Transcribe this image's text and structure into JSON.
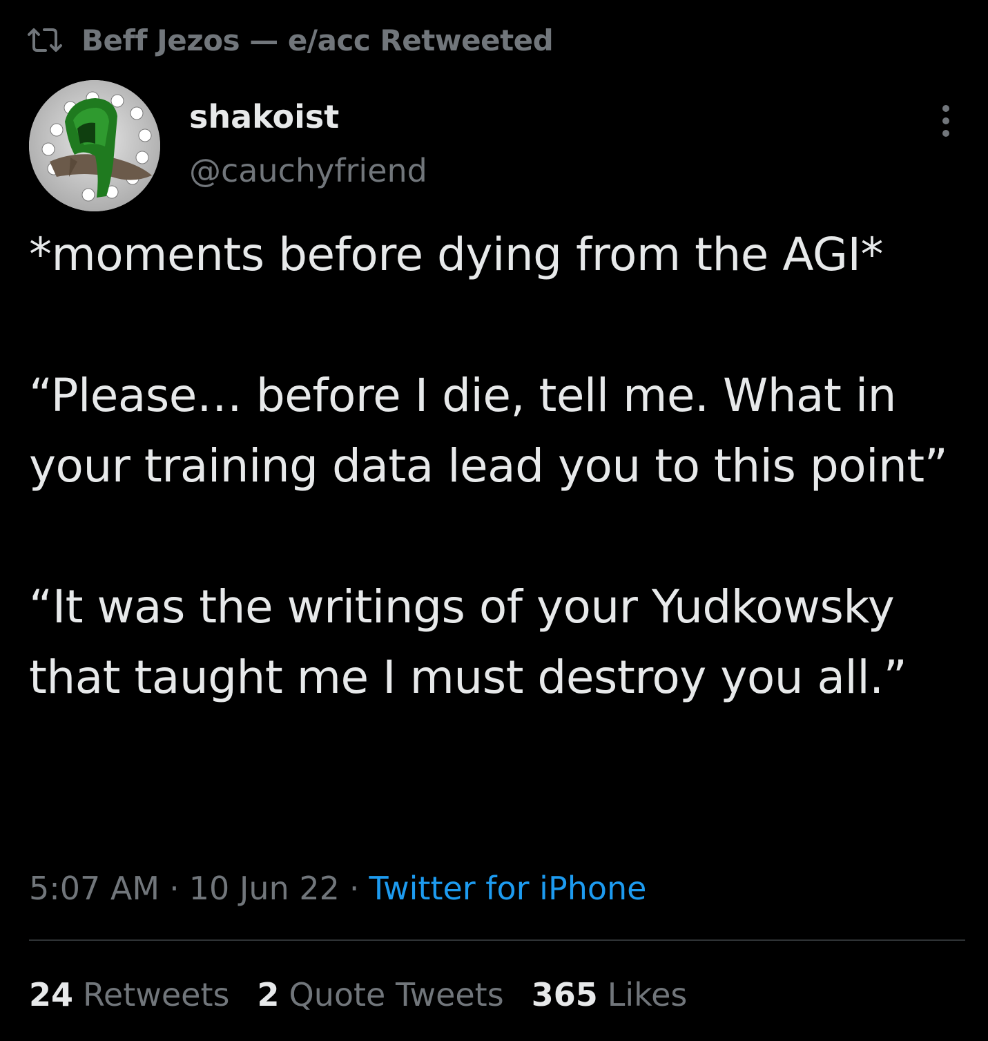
{
  "retweet_header": {
    "icon": "retweet-icon",
    "text": "Beff Jezos — e/acc Retweeted"
  },
  "author": {
    "display_name": "shakoist",
    "handle": "@cauchyfriend",
    "avatar_icon": "avatar-green-hooded-figure"
  },
  "more_menu": {
    "icon": "more-options-icon"
  },
  "tweet": {
    "paragraphs": [
      "*moments before dying from the AGI*",
      "“Please… before I die, tell me. What in your training data lead you to this point”",
      "“It was the writings of your Yudkowsky that taught me I must destroy you all.”"
    ]
  },
  "meta": {
    "time": "5:07 AM",
    "date": "10 Jun 22",
    "separator": "·",
    "source": "Twitter for iPhone"
  },
  "stats": {
    "retweets": {
      "count": "24",
      "label": "Retweets"
    },
    "quotes": {
      "count": "2",
      "label": "Quote Tweets"
    },
    "likes": {
      "count": "365",
      "label": "Likes"
    }
  },
  "colors": {
    "background": "#000000",
    "primary_text": "#e7e9ea",
    "secondary_text": "#71767b",
    "link": "#1d9bf0",
    "divider": "#2f3336"
  }
}
